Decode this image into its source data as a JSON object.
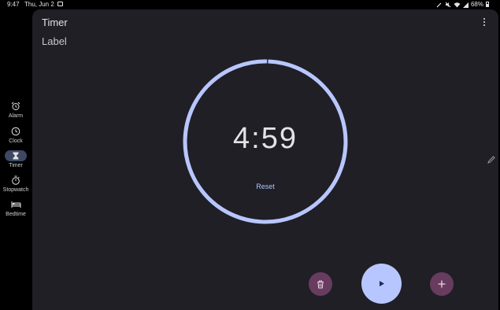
{
  "status_bar": {
    "time": "9:47",
    "date": "Thu, Jun 2",
    "battery": "68%"
  },
  "nav": {
    "items": [
      {
        "label": "Alarm",
        "icon": "alarm-icon"
      },
      {
        "label": "Clock",
        "icon": "clock-icon"
      },
      {
        "label": "Timer",
        "icon": "hourglass-icon",
        "active": true
      },
      {
        "label": "Stopwatch",
        "icon": "stopwatch-icon"
      },
      {
        "label": "Bedtime",
        "icon": "bed-icon"
      }
    ]
  },
  "header": {
    "title": "Timer",
    "menu_icon": "more-vert-icon"
  },
  "timer": {
    "label": "Label",
    "value": "4:59",
    "reset_label": "Reset",
    "progress_remaining": 0.997
  },
  "actions": {
    "delete_icon": "delete-icon",
    "play_icon": "play-icon",
    "add_icon": "add-icon"
  },
  "colors": {
    "accent": "#b8c6ff",
    "secondary_button": "#683c5f",
    "surface": "#1f1f25",
    "active_nav": "#3d4863"
  }
}
